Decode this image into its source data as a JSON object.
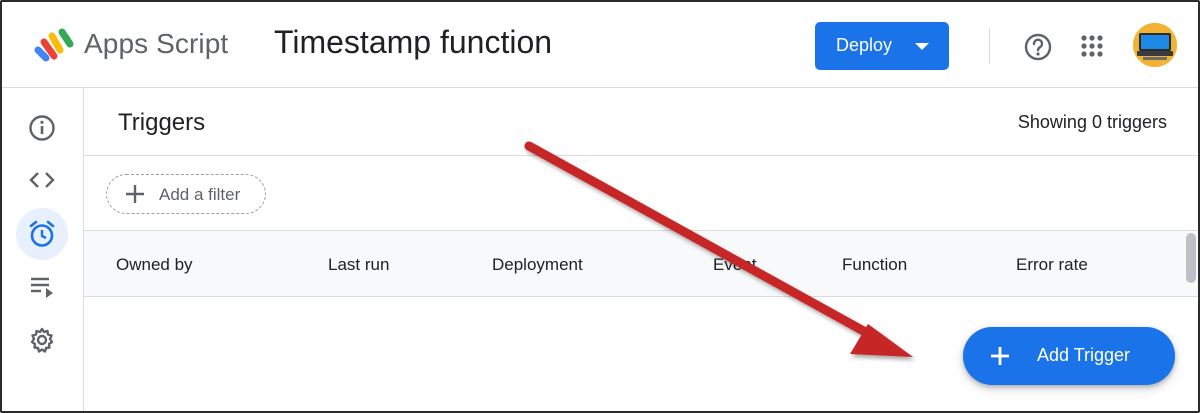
{
  "header": {
    "app_name": "Apps Script",
    "project_title": "Timestamp function",
    "deploy_label": "Deploy",
    "icons": [
      "apps-script-logo",
      "help-icon",
      "apps-grid-icon",
      "avatar"
    ]
  },
  "sidebar": {
    "items": [
      {
        "icon": "info-icon",
        "label": "Overview"
      },
      {
        "icon": "code-icon",
        "label": "Editor"
      },
      {
        "icon": "alarm-clock-icon",
        "label": "Triggers",
        "active": true
      },
      {
        "icon": "executions-icon",
        "label": "Executions"
      },
      {
        "icon": "gear-icon",
        "label": "Project Settings"
      }
    ]
  },
  "main": {
    "title": "Triggers",
    "showing": "Showing 0 triggers",
    "filter_label": "Add a filter",
    "columns": [
      "Owned by",
      "Last run",
      "Deployment",
      "Event",
      "Function",
      "Error rate"
    ],
    "add_trigger_label": "Add Trigger"
  },
  "colors": {
    "primary": "#1a73e8",
    "annotation_arrow": "#c62828"
  }
}
